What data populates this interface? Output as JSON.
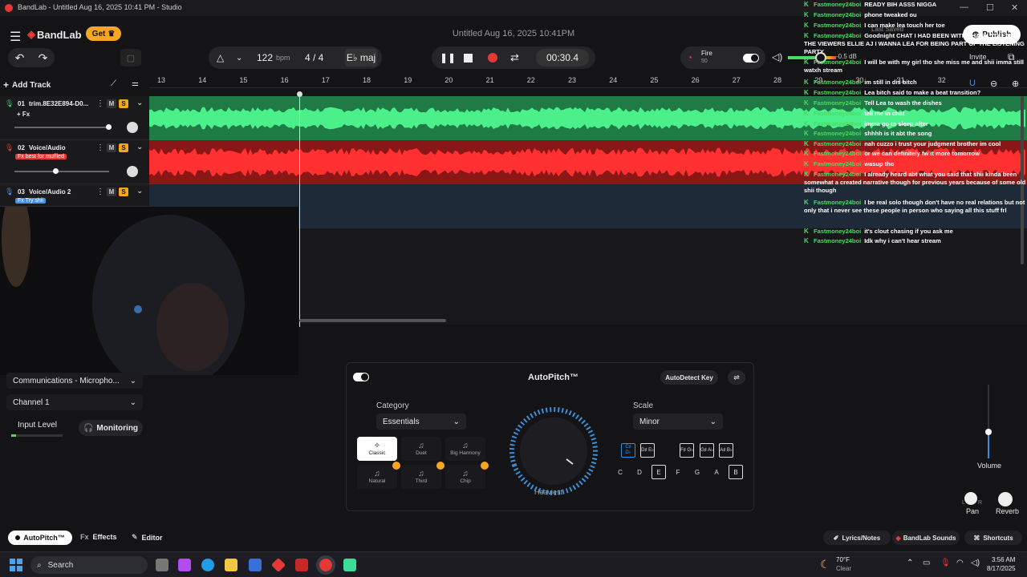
{
  "window": {
    "title": "BandLab - Untitled Aug 16, 2025 10:41 PM - Studio"
  },
  "header": {
    "logo": "BandLab",
    "get_label": "Get",
    "project_title": "Untitled Aug 16, 2025 10:41PM",
    "last_saved": "Last Saved",
    "publish": "Publish",
    "invite": "Invite"
  },
  "toolbar": {
    "bpm_value": "122",
    "bpm_unit": "bpm",
    "time_sig": "4 / 4",
    "key": "E♭ maj",
    "time": "00:30.4",
    "preset_name": "Fire",
    "preset_value": "50",
    "volume_db": "-0.5 dB",
    "add_track": "Add Track"
  },
  "ruler": {
    "ticks": [
      "13",
      "14",
      "15",
      "16",
      "17",
      "18",
      "19",
      "20",
      "21",
      "22",
      "23",
      "24",
      "25",
      "26",
      "27",
      "28",
      "29",
      "30",
      "31",
      "32"
    ]
  },
  "tracks": [
    {
      "num": "01",
      "name": "trim.8E32E894-D0...",
      "fx": "+ Fx",
      "fx_badge": ""
    },
    {
      "num": "02",
      "name": "Voice/Audio",
      "fx": "",
      "fx_badge": "Fx best for muffled"
    },
    {
      "num": "03",
      "name": "Voice/Audio 2",
      "fx": "",
      "fx_badge": "Fx Try shii"
    }
  ],
  "track_buttons": {
    "mute": "M",
    "solo": "S"
  },
  "chat": [
    {
      "user": "Fastmoney24boi",
      "msg": "READY BIH ASSS NIGGA"
    },
    {
      "user": "Fastmoney24boi",
      "msg": "phone tweaked ou"
    },
    {
      "user": "Fastmoney24boi",
      "msg": "I can make lea touch her toe"
    },
    {
      "user": "Fastmoney24boi",
      "msg": "Goodnight CHAT I HAD BEEN WITH THANK YOU ALL THE VIEWERS ELLIE AJ I WANNA LEA FOR BEING PART OF THE LISTENING PARTY"
    },
    {
      "user": "Fastmoney24boi",
      "msg": "I will be with my girl tho she miss me and shii imma still watxh stream"
    },
    {
      "user": "Fastmoney24boi",
      "msg": "im still in dis bitch"
    },
    {
      "user": "Fastmoney24boi",
      "msg": "Lea bitch said to make a beat transition?"
    },
    {
      "user": "Fastmoney24boi",
      "msg": "Tell Lea to wash the dishes"
    },
    {
      "user": "Fastmoney24boi",
      "msg": "tell me in chat"
    },
    {
      "user": "Fastmoney24boi",
      "msg": "imma go to sleep after"
    },
    {
      "user": "Fastmoney24boi",
      "msg": "shhhh is it abt the song"
    },
    {
      "user": "Fastmoney24boi",
      "msg": "nah cuzzo i trust your judgment brother im cool"
    },
    {
      "user": "Fastmoney24boi",
      "msg": "or we can definitely fw it more tomorrow"
    },
    {
      "user": "Fastmoney24boi",
      "msg": "wasup tho"
    },
    {
      "user": "Fastmoney24boi",
      "msg": "I already heard abt what you said that shii kinda been somewhat a created narrative though for previous years because of some old shii though"
    },
    {
      "user": "Fastmoney24boi",
      "msg": "I be real solo though don't have no real relations but not only that i never see these people in person who saying all this stuff frl"
    },
    {
      "user": "Fastmoney24boi",
      "msg": "it's clout chasing if you ask me"
    },
    {
      "user": "Fastmoney24boi",
      "msg": "Idk why i can't hear stream"
    }
  ],
  "input": {
    "device": "Communications - Micropho...",
    "channel": "Channel 1",
    "level_label": "Input Level",
    "monitoring": "Monitoring"
  },
  "autopitch": {
    "title": "AutoPitch™",
    "autodetect": "AutoDetect Key",
    "category_label": "Category",
    "category_value": "Essentials",
    "scale_label": "Scale",
    "scale_value": "Minor",
    "dial_label": "Heaviest",
    "presets": [
      "Classic",
      "Duet",
      "Big Harmony",
      "Natural",
      "Third",
      "Chip"
    ],
    "sharp_keys": [
      "C♯ D♭",
      "D♯ E♭",
      "F♯ G♭",
      "G♯ A♭",
      "A♯ B♭"
    ],
    "natural_keys": [
      "C",
      "D",
      "E",
      "F",
      "G",
      "A",
      "B"
    ]
  },
  "mixer": {
    "volume": "Volume",
    "pan": "Pan",
    "reverb": "Reverb",
    "pan_l": "L",
    "pan_r": "R"
  },
  "bottom": {
    "autopitch_tab": "AutoPitch™",
    "effects_tab": "Effects",
    "editor_tab": "Editor",
    "lyrics": "Lyrics/Notes",
    "sounds": "BandLab Sounds",
    "shortcuts": "Shortcuts"
  },
  "taskbar": {
    "search": "Search",
    "temp": "70°F",
    "weather": "Clear",
    "time": "3:56 AM",
    "date": "8/17/2025"
  },
  "colors": {
    "accent": "#f5a623",
    "track1": "#2ecc71",
    "track2": "#e53935",
    "track3": "#2b3a4d",
    "chat_user": "#4cd964"
  }
}
